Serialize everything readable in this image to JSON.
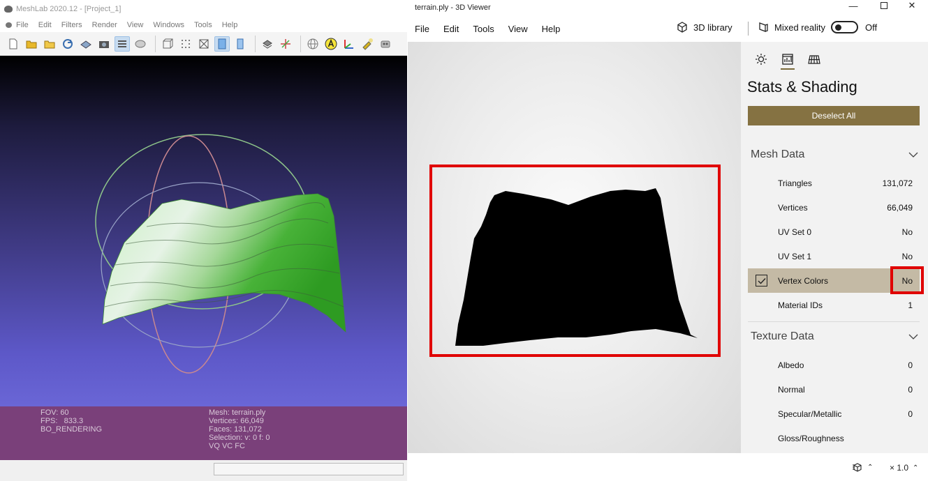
{
  "meshlab": {
    "title": "MeshLab 2020.12 - [Project_1]",
    "menu": [
      "File",
      "Edit",
      "Filters",
      "Render",
      "View",
      "Windows",
      "Tools",
      "Help"
    ],
    "info_left": [
      "FOV: 60",
      "FPS:   833.3",
      "BO_RENDERING"
    ],
    "info_right": [
      "Mesh: terrain.ply",
      "Vertices: 66,049",
      "Faces: 131,072",
      "Selection: v: 0 f: 0",
      "VQ VC FC"
    ]
  },
  "viewer": {
    "title": "terrain.ply - 3D Viewer",
    "menu": [
      "File",
      "Edit",
      "Tools",
      "View",
      "Help"
    ],
    "library_label": "3D library",
    "mixed_reality_label": "Mixed reality",
    "toggle_state": "Off",
    "panel_title": "Stats & Shading",
    "deselect_label": "Deselect All",
    "mesh_section": "Mesh Data",
    "mesh_rows": [
      {
        "label": "Triangles",
        "value": "131,072"
      },
      {
        "label": "Vertices",
        "value": "66,049"
      },
      {
        "label": "UV Set 0",
        "value": "No"
      },
      {
        "label": "UV Set 1",
        "value": "No"
      },
      {
        "label": "Vertex Colors",
        "value": "No"
      },
      {
        "label": "Material IDs",
        "value": "1"
      }
    ],
    "texture_section": "Texture Data",
    "texture_rows": [
      {
        "label": "Albedo",
        "value": "0"
      },
      {
        "label": "Normal",
        "value": "0"
      },
      {
        "label": "Specular/Metallic",
        "value": "0"
      },
      {
        "label": "Gloss/Roughness",
        "value": ""
      }
    ],
    "zoom": "× 1.0"
  },
  "colors": {
    "accent": "#857242",
    "highlight": "#e00000",
    "selected_row": "#c4baa5",
    "meshlab_info_bg": "#7a407a"
  }
}
